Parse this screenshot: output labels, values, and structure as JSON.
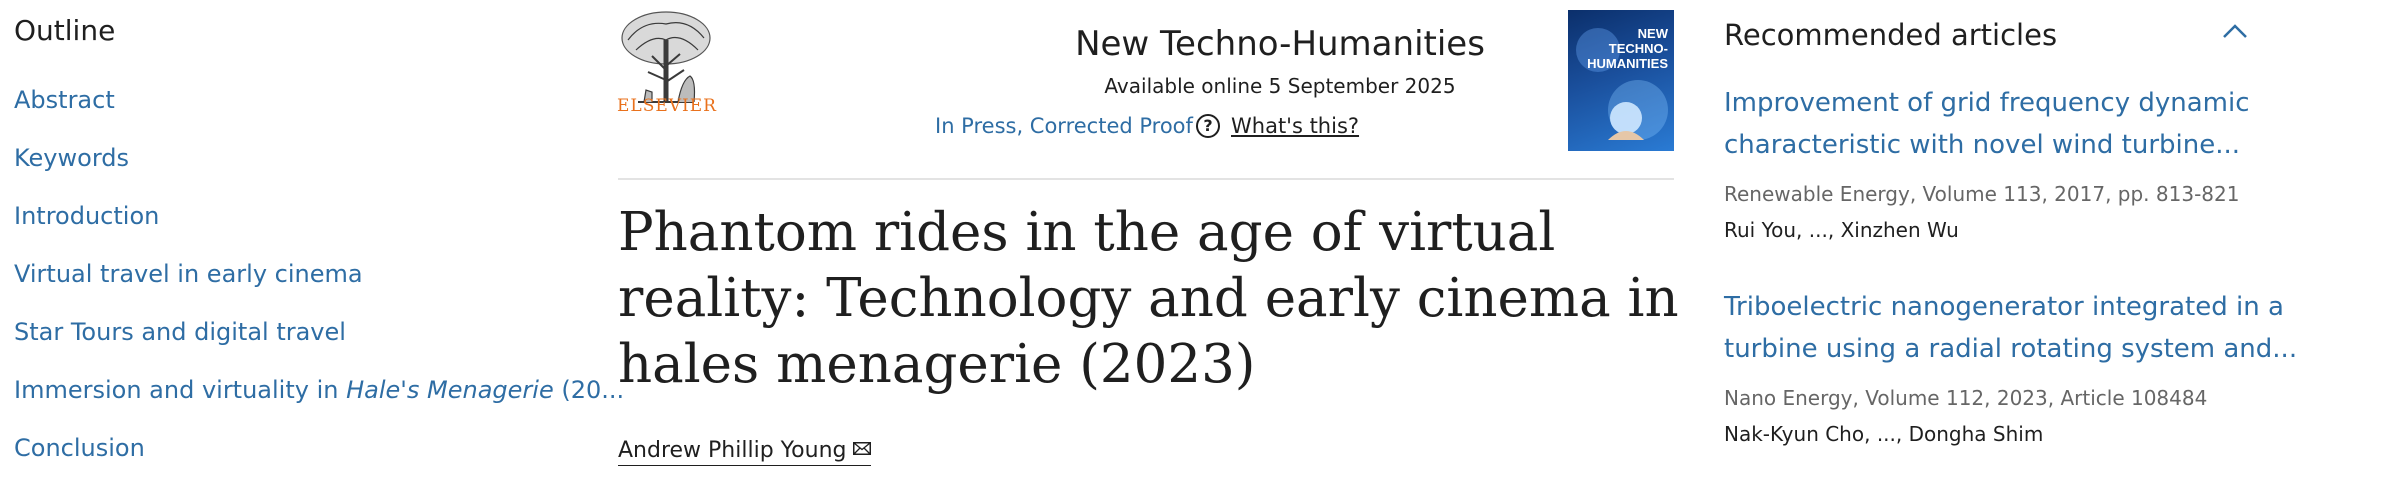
{
  "outline": {
    "title": "Outline",
    "items": [
      {
        "label": "Abstract"
      },
      {
        "label": "Keywords"
      },
      {
        "label": "Introduction"
      },
      {
        "label": "Virtual travel in early cinema"
      },
      {
        "label": "Star Tours and digital travel"
      },
      {
        "label_pre": "Immersion and virtuality in ",
        "label_em": "Hale's Menagerie",
        "label_post": " (20..."
      },
      {
        "label": "Conclusion"
      }
    ]
  },
  "header": {
    "publisher": "ELSEVIER",
    "journal_title": "New Techno-Humanities",
    "available": "Available online 5 September 2025",
    "status": "In Press, Corrected Proof",
    "whats_this": "What's this?",
    "help_glyph": "?",
    "cover_text": [
      "NEW",
      "TECHNO-",
      "HUMANITIES"
    ]
  },
  "article": {
    "title": "Phantom rides in the age of virtual reality: Technology and early cinema in hales menagerie (2023)",
    "author": "Andrew Phillip Young"
  },
  "recommended": {
    "title": "Recommended articles",
    "items": [
      {
        "title_l1": "Improvement of grid frequency dynamic",
        "title_l2": "characteristic with novel wind turbine...",
        "source": "Renewable Energy, Volume 113, 2017, pp. 813-821",
        "authors": "Rui You, ..., Xinzhen Wu"
      },
      {
        "title_l1": "Triboelectric nanogenerator integrated in a",
        "title_l2": "turbine using a radial rotating system and...",
        "source": "Nano Energy, Volume 112, 2023, Article 108484",
        "authors": "Nak-Kyun Cho, ..., Dongha Shim"
      }
    ]
  },
  "colors": {
    "link": "#2e6da4",
    "text": "#1f1f1f",
    "muted": "#666666",
    "elsevier_orange": "#e9711c"
  }
}
